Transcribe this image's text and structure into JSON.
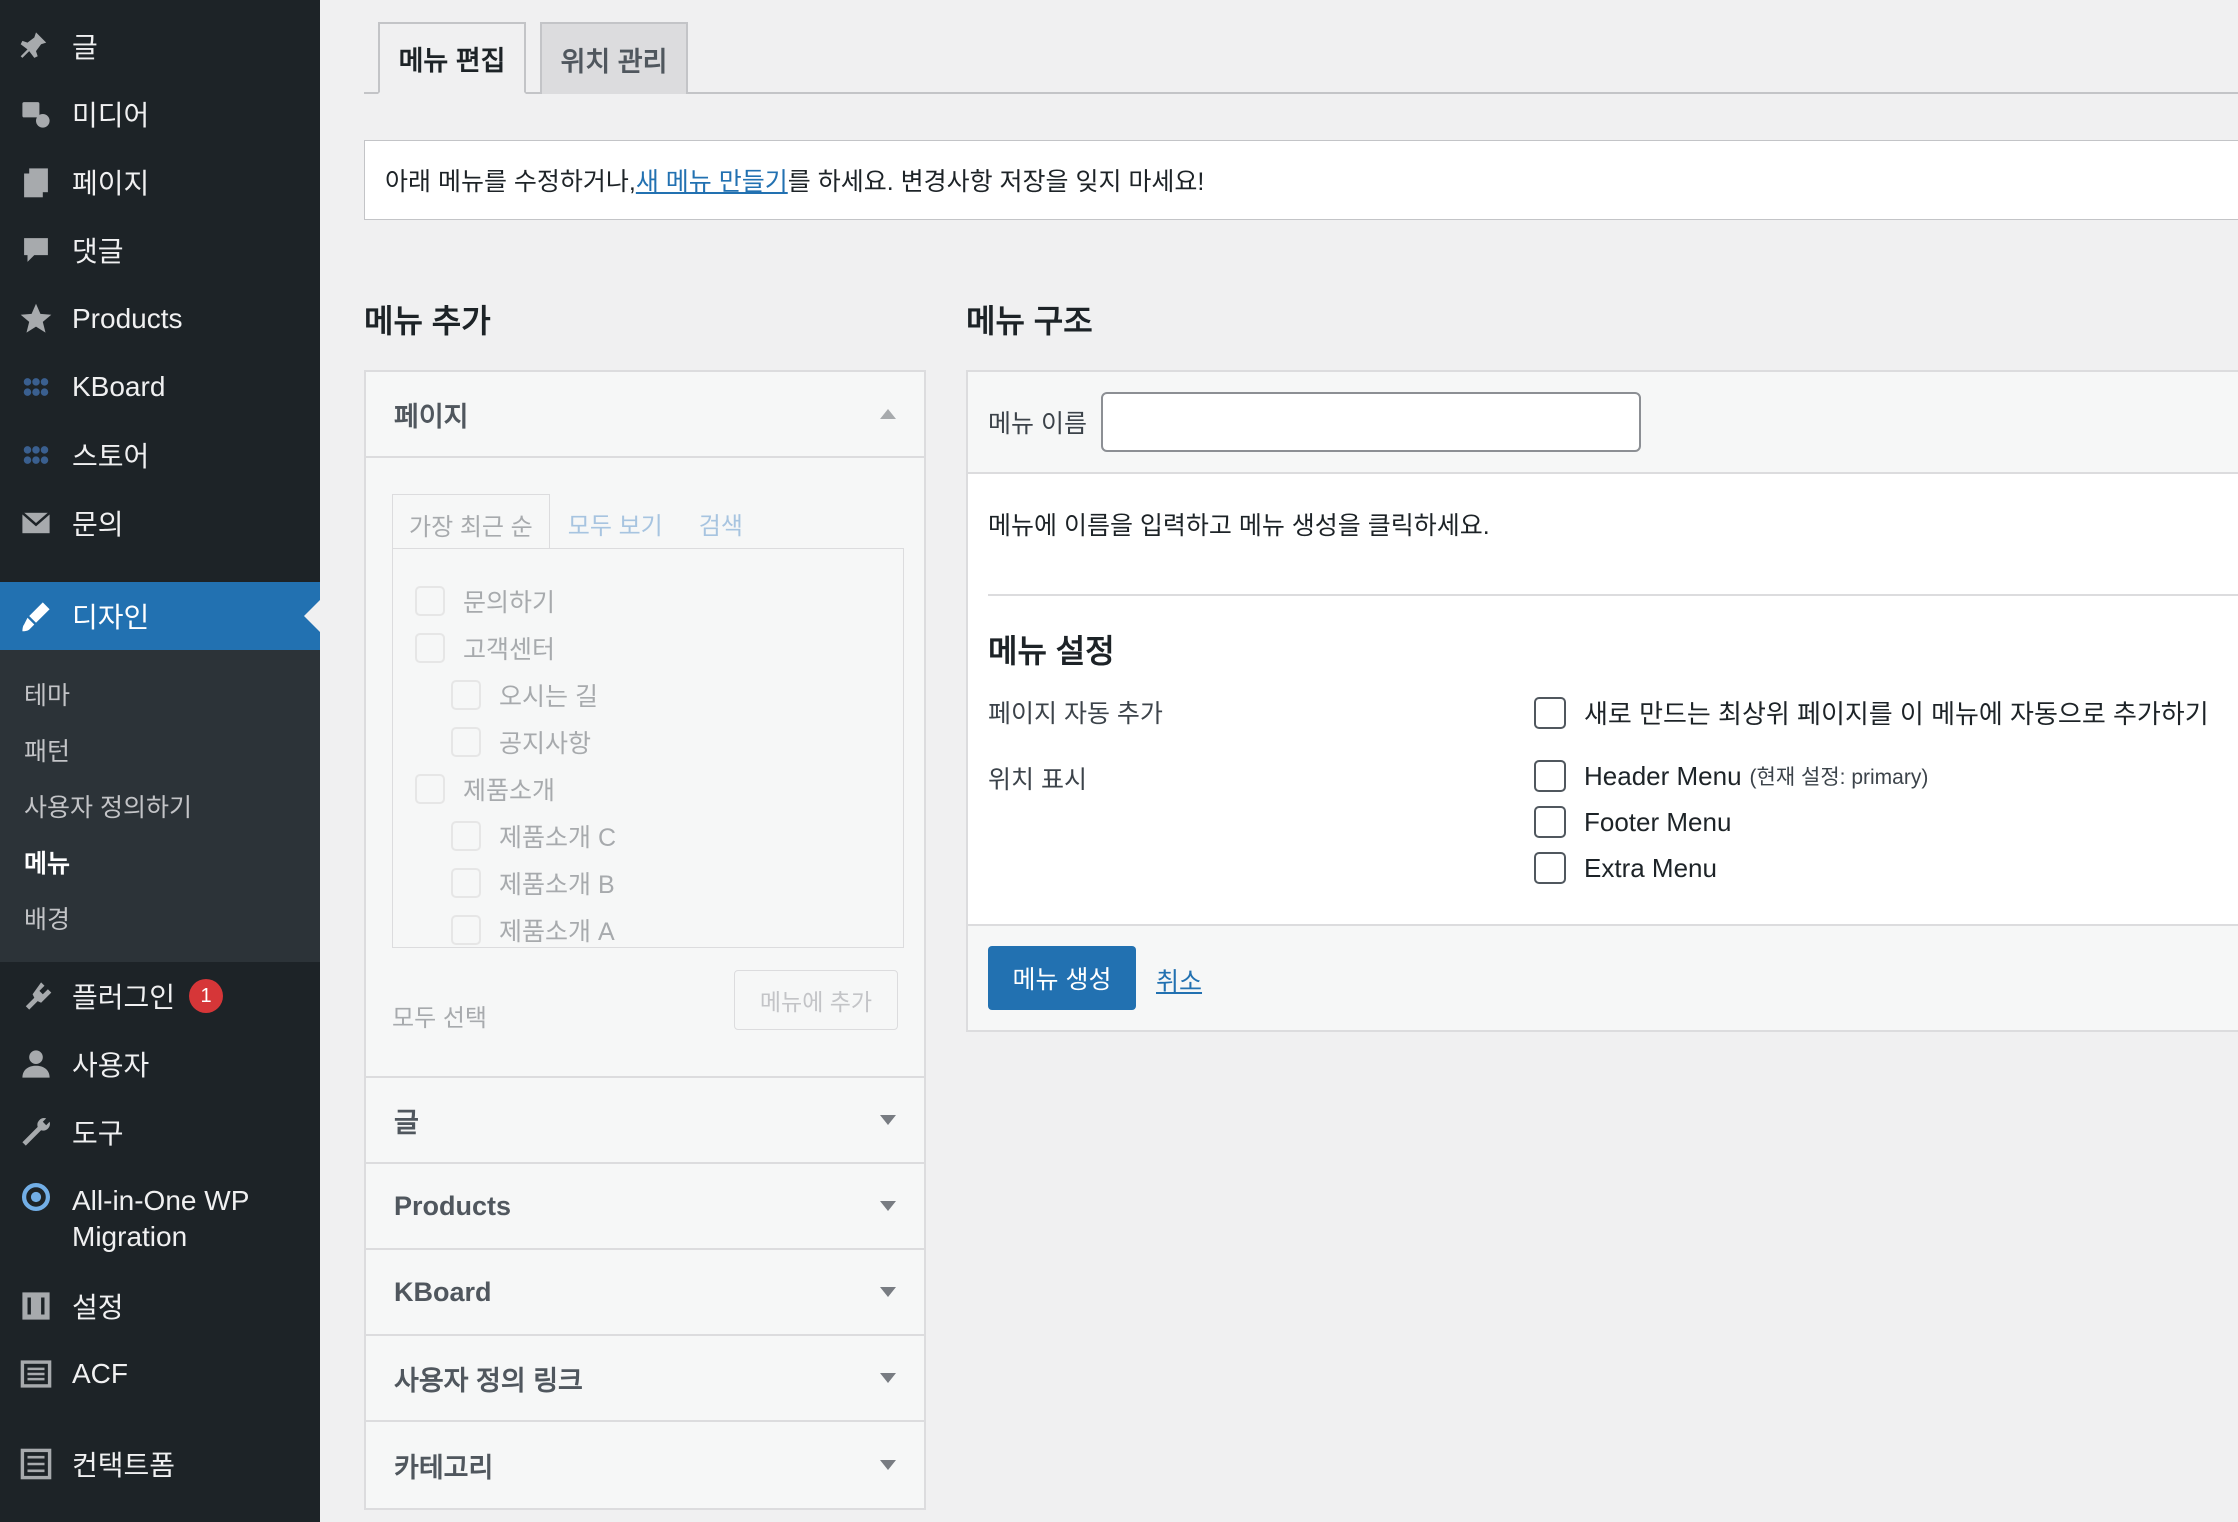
{
  "sidebar": {
    "items": [
      {
        "label": "글",
        "icon": "pushpin-icon"
      },
      {
        "label": "미디어",
        "icon": "media-icon"
      },
      {
        "label": "페이지",
        "icon": "pages-icon"
      },
      {
        "label": "댓글",
        "icon": "comment-icon"
      },
      {
        "label": "Products",
        "icon": "star-icon"
      },
      {
        "label": "KBoard",
        "icon": "dots-icon"
      },
      {
        "label": "스토어",
        "icon": "dots-icon"
      },
      {
        "label": "문의",
        "icon": "mail-icon"
      },
      {
        "label": "디자인",
        "icon": "brush-icon"
      },
      {
        "label": "플러그인",
        "icon": "plugin-icon",
        "badge": "1"
      },
      {
        "label": "사용자",
        "icon": "user-icon"
      },
      {
        "label": "도구",
        "icon": "wrench-icon"
      },
      {
        "label": "All-in-One WP",
        "label2": "Migration",
        "icon": "migration-icon"
      },
      {
        "label": "설정",
        "icon": "settings-icon"
      },
      {
        "label": "ACF",
        "icon": "acf-icon"
      },
      {
        "label": "컨택트폼",
        "icon": "form-icon"
      }
    ],
    "submenu": [
      "테마",
      "패턴",
      "사용자 정의하기",
      "메뉴",
      "배경"
    ]
  },
  "tabs": [
    "메뉴 편집",
    "위치 관리"
  ],
  "notice": {
    "before": "아래 메뉴를 수정하거나, ",
    "link": "새 메뉴 만들기",
    "after": "를 하세요. 변경사항 저장을 잊지 마세요!"
  },
  "add_menu": {
    "title": "메뉴 추가",
    "open_section": "페이지",
    "inner_tabs": [
      "가장 최근 순",
      "모두 보기",
      "검색"
    ],
    "pages": [
      "문의하기",
      "고객센터",
      "오시는 길",
      "공지사항",
      "제품소개",
      "제품소개 C",
      "제품소개 B",
      "제품소개 A"
    ],
    "select_all": "모두 선택",
    "add_button": "메뉴에 추가",
    "sections": [
      "글",
      "Products",
      "KBoard",
      "사용자 정의 링크",
      "카테고리"
    ]
  },
  "structure": {
    "title": "메뉴 구조",
    "name_label": "메뉴 이름",
    "name_value": "",
    "hint": "메뉴에 이름을 입력하고 메뉴 생성을 클릭하세요.",
    "settings_title": "메뉴 설정",
    "auto_add_label": "페이지 자동 추가",
    "auto_add_option": "새로 만드는 최상위 페이지를 이 메뉴에 자동으로 추가하기",
    "location_label": "위치 표시",
    "locations": [
      {
        "name": "Header Menu",
        "note": "(현재 설정: primary)"
      },
      {
        "name": "Footer Menu",
        "note": ""
      },
      {
        "name": "Extra Menu",
        "note": ""
      }
    ],
    "create_button": "메뉴 생성",
    "cancel_link": "취소"
  }
}
